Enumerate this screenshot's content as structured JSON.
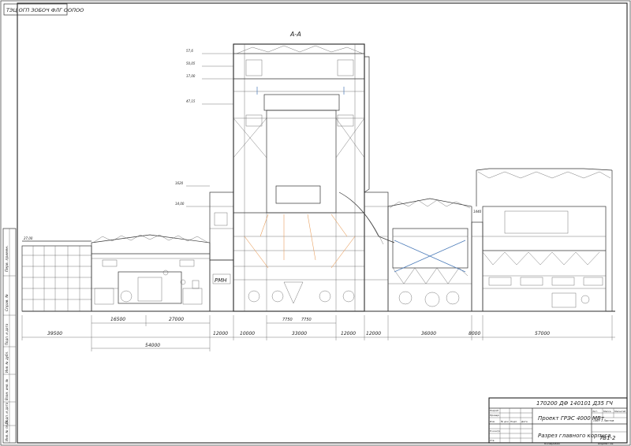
{
  "stamp_top": "ТЭЦ ОГП ЗОБОЧ ФЛГ ООПОО",
  "section_title": "А-А",
  "levels": [
    "57,6",
    "50,05",
    "17,00",
    "47,15",
    "1620",
    "14,00",
    "27,00",
    "1440"
  ],
  "rmn_label": "РМН",
  "dimensions_row1": [
    "39500",
    "16500",
    "27000",
    "12000",
    "10000",
    "33000",
    "12000",
    "12000",
    "36000",
    "8000",
    "57000"
  ],
  "dimensions_row2": [
    "54000"
  ],
  "dim_small": [
    "7750",
    "7750"
  ],
  "title_block": {
    "doc_code": "170200 ДФ 140101 Д35 ГЧ",
    "project": "Проект ГРЭС 4000 МВт",
    "sheet_title": "Разрез главного корпуса",
    "sheet_code": "ТБ1-2",
    "col_headers": [
      "Изм",
      "Кол.уч",
      "Лист",
      "№ док",
      "Подп.",
      "Дата"
    ],
    "row_labels": [
      "Разраб.",
      "Провер.",
      "Т.контр.",
      "Н.контр.",
      "Утв."
    ],
    "stage_headers": [
      "Лит.",
      "Масса",
      "Масштаб"
    ],
    "sheet_info": "Лист 1 Листов",
    "copied": "Копировал",
    "format": "Формат А1"
  },
  "side_stamps": [
    "Перв. примен.",
    "Справ. №",
    "Подп. и дата",
    "Инв. № дубл.",
    "Взам. инв. №",
    "Подп. и дата",
    "Инв. № подл."
  ]
}
